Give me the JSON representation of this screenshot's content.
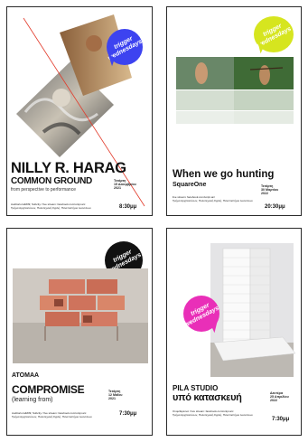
{
  "posters": [
    {
      "badge": {
        "line1": "trigger",
        "line2": "wednesdays",
        "color": "#3d43f0"
      },
      "title": "NILLY R. HARAG",
      "subtitle": "COMMON GROUND",
      "tagline": "from perspective to performance",
      "date": [
        "Τετάρτη",
        "15 Δεκεμβρίου",
        "2021"
      ],
      "meta": [
        "Auditorium&#39; Subcity / live stream: facebook.com/unipi.arc",
        "Τμήμα Αρχιτεκτόνων, Πολυτεχνική Σχολή, Πανεπιστήμιο Ιωαννίνων"
      ],
      "time": "8:30μμ"
    },
    {
      "badge": {
        "line1": "trigger",
        "line2": "wednesdays",
        "color": "#d6e51f"
      },
      "title": "When we go hunting",
      "subtitle": "SquareOne",
      "date": [
        "Τετάρτη",
        "30 Μαρτίου",
        "2022"
      ],
      "meta": [
        "live stream: facebook.com/unipi.arc",
        "Τμήμα Αρχιτεκτόνων, Πολυτεχνική Σχολή, Πανεπιστήμιο Ιωαννίνων"
      ],
      "time": "20:30μμ"
    },
    {
      "badge": {
        "line1": "trigger",
        "line2": "wednesdays",
        "color": "#111111"
      },
      "studio": "ATOMAA",
      "title": "COMPROMISE",
      "tagline": "(learning from)",
      "date": [
        "Τετάρτη",
        "12 Μαΐου",
        "2021"
      ],
      "meta": [
        "Auditorium&#39; Subcity / live stream: facebook.com/unipi.arc",
        "Τμήμα Αρχιτεκτόνων, Πολυτεχνική Σχολή, Πανεπιστήμιο Ιωαννίνων"
      ],
      "time": "7:30μμ"
    },
    {
      "badge": {
        "line1": "trigger",
        "line2": "wednesdays",
        "color": "#e92fb8"
      },
      "studio": "PILA STUDIO",
      "title": "υπό κατασκευή",
      "date": [
        "Δευτέρα",
        "25 Απριλίου",
        "2022"
      ],
      "meta": [
        "Ονομ/Ερευνα / live stream: facebook.com/unipi.arc",
        "Τμήμα Αρχιτεκτόνων, Πολυτεχνική Σχολή, Πανεπιστήμιο Ιωαννίνων"
      ],
      "time": "7:30μμ"
    }
  ]
}
